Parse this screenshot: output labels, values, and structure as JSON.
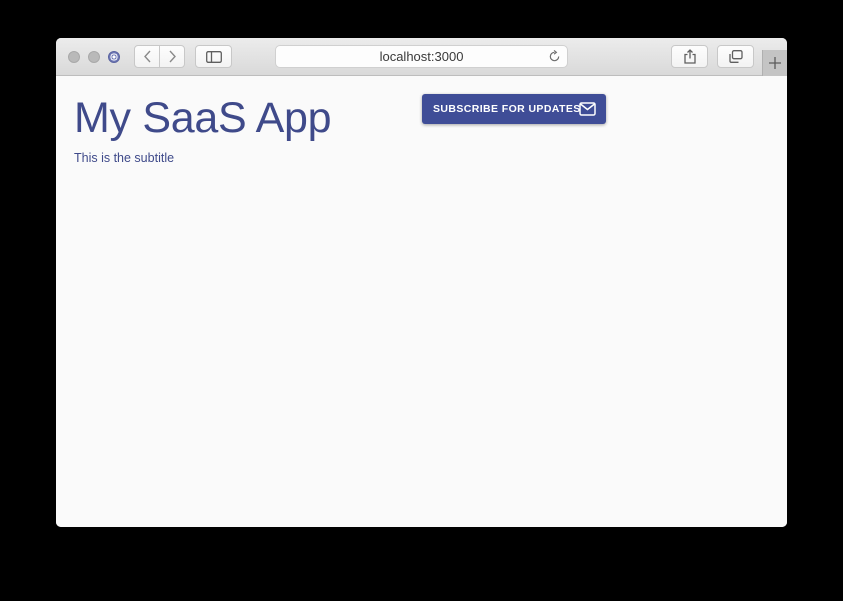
{
  "browser": {
    "url": "localhost:3000",
    "icons": {
      "back": "chevron-left-icon",
      "forward": "chevron-right-icon",
      "sidebar": "sidebar-icon",
      "reload": "reload-icon",
      "share": "share-icon",
      "tabs": "tabs-icon",
      "new_tab": "plus-icon"
    }
  },
  "page": {
    "title": "My SaaS App",
    "subtitle": "This is the subtitle",
    "subscribe_label": "SUBSCRIBE FOR UPDATES",
    "subscribe_icon": "mail-icon"
  },
  "colors": {
    "accent": "#3f4d97",
    "title": "#3f4a8a",
    "background": "#fafafa"
  }
}
